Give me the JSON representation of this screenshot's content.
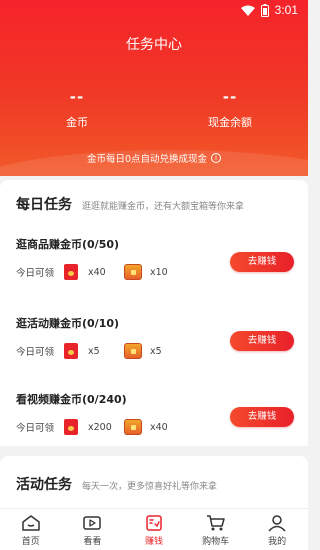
{
  "status_bar": {
    "time": "3:01"
  },
  "header": {
    "title": "任务中心",
    "coins": {
      "value": "--",
      "label": "金币"
    },
    "cash": {
      "value": "--",
      "label": "现金余额"
    },
    "notice": "金币每日0点自动兑换成现金",
    "info_icon": "i"
  },
  "daily": {
    "title": "每日任务",
    "subtitle": "逛逛就能赚金币，还有大额宝箱等你来拿",
    "tasks": [
      {
        "name": "逛商品赚金币(0/50)",
        "today": "今日可领",
        "envelope_count": "x40",
        "chest_count": "x10",
        "button": "去赚钱"
      },
      {
        "name": "逛活动赚金币(0/10)",
        "today": "今日可领",
        "envelope_count": "x5",
        "chest_count": "x5",
        "button": "去赚钱"
      },
      {
        "name": "看视频赚金币(0/240)",
        "today": "今日可领",
        "envelope_count": "x200",
        "chest_count": "x40",
        "button": "去赚钱"
      }
    ]
  },
  "activity": {
    "title": "活动任务",
    "subtitle": "每天一次，更多惊喜好礼等你来拿"
  },
  "tabbar": {
    "items": [
      {
        "label": "首页",
        "icon": "home-icon"
      },
      {
        "label": "看看",
        "icon": "video-icon"
      },
      {
        "label": "赚钱",
        "icon": "earn-icon"
      },
      {
        "label": "购物车",
        "icon": "cart-icon"
      },
      {
        "label": "我的",
        "icon": "profile-icon"
      }
    ],
    "active_index": 2
  },
  "colors": {
    "accent": "#e8242a",
    "header_top": "#f5232a"
  }
}
